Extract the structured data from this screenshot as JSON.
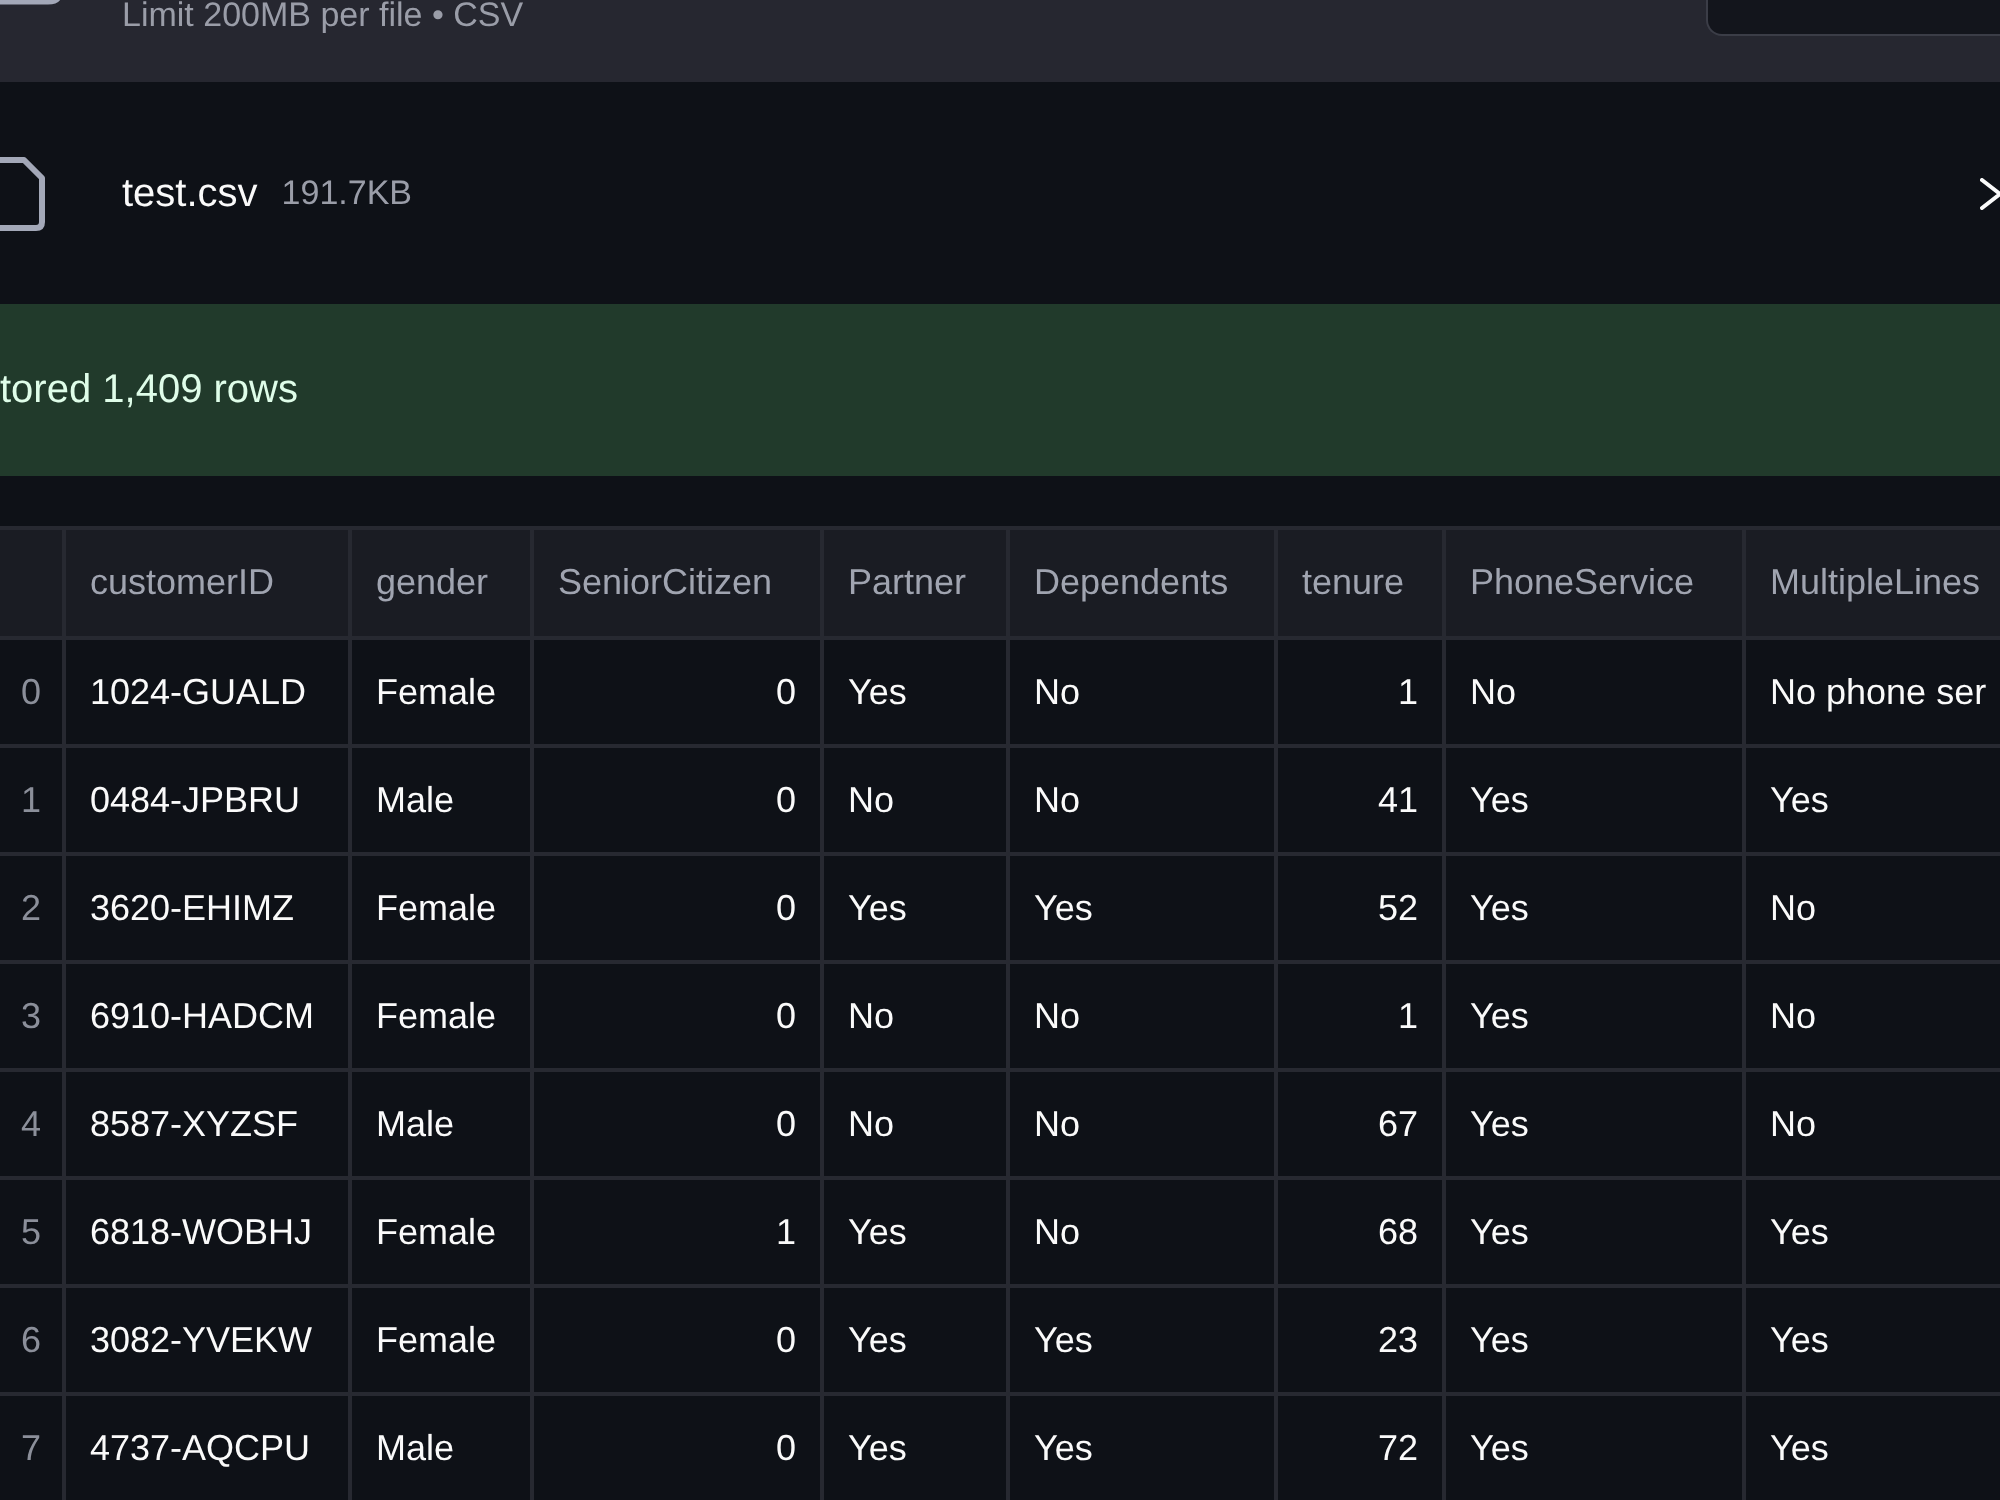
{
  "uploader": {
    "limit_text": "Limit 200MB per file • CSV"
  },
  "file": {
    "name": "test.csv",
    "size": "191.7KB"
  },
  "alert": {
    "kind": "success",
    "message": "tored 1,409 rows"
  },
  "table": {
    "columns": [
      {
        "label": "customerID",
        "kind": "text"
      },
      {
        "label": "gender",
        "kind": "text"
      },
      {
        "label": "SeniorCitizen",
        "kind": "number"
      },
      {
        "label": "Partner",
        "kind": "text"
      },
      {
        "label": "Dependents",
        "kind": "text"
      },
      {
        "label": "tenure",
        "kind": "number"
      },
      {
        "label": "PhoneService",
        "kind": "text"
      },
      {
        "label": "MultipleLines",
        "kind": "text"
      }
    ],
    "rows": [
      {
        "index": "0",
        "cells": [
          "1024-GUALD",
          "Female",
          "0",
          "Yes",
          "No",
          "1",
          "No",
          "No phone ser"
        ]
      },
      {
        "index": "1",
        "cells": [
          "0484-JPBRU",
          "Male",
          "0",
          "No",
          "No",
          "41",
          "Yes",
          "Yes"
        ]
      },
      {
        "index": "2",
        "cells": [
          "3620-EHIMZ",
          "Female",
          "0",
          "Yes",
          "Yes",
          "52",
          "Yes",
          "No"
        ]
      },
      {
        "index": "3",
        "cells": [
          "6910-HADCM",
          "Female",
          "0",
          "No",
          "No",
          "1",
          "Yes",
          "No"
        ]
      },
      {
        "index": "4",
        "cells": [
          "8587-XYZSF",
          "Male",
          "0",
          "No",
          "No",
          "67",
          "Yes",
          "No"
        ]
      },
      {
        "index": "5",
        "cells": [
          "6818-WOBHJ",
          "Female",
          "1",
          "Yes",
          "No",
          "68",
          "Yes",
          "Yes"
        ]
      },
      {
        "index": "6",
        "cells": [
          "3082-YVEKW",
          "Female",
          "0",
          "Yes",
          "Yes",
          "23",
          "Yes",
          "Yes"
        ]
      },
      {
        "index": "7",
        "cells": [
          "4737-AQCPU",
          "Male",
          "0",
          "Yes",
          "Yes",
          "72",
          "Yes",
          "Yes"
        ]
      }
    ]
  }
}
